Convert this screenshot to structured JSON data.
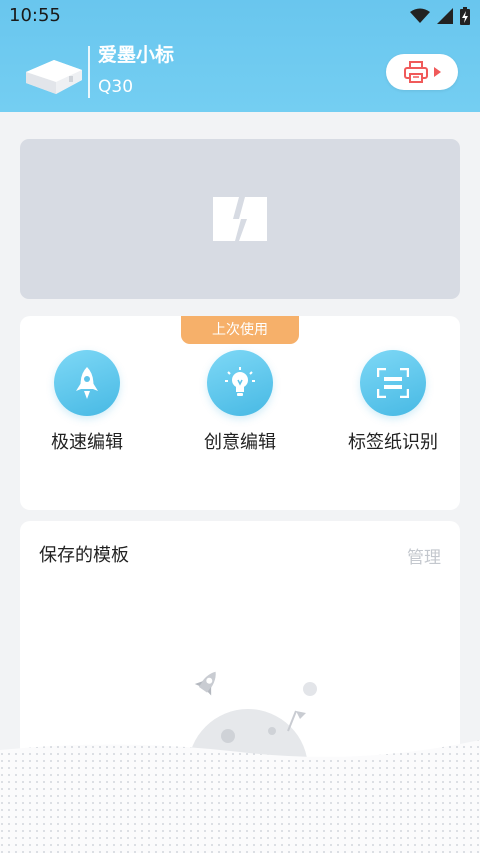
{
  "status_bar": {
    "time": "10:55",
    "icons": [
      "wifi-icon",
      "signal-icon",
      "battery-charging-icon"
    ]
  },
  "header": {
    "device_name": "爱墨小标",
    "device_model": "Q30",
    "print_button_icon": "printer-icon"
  },
  "banner": {
    "icon": "image-placeholder-icon"
  },
  "quick_actions": {
    "badge": "上次使用",
    "items": [
      {
        "label": "极速编辑",
        "icon": "rocket-icon"
      },
      {
        "label": "创意编辑",
        "icon": "lightbulb-icon"
      },
      {
        "label": "标签纸识别",
        "icon": "scan-icon"
      }
    ]
  },
  "templates": {
    "title": "保存的模板",
    "manage_label": "管理",
    "empty_illustration": "rocket-planet-illustration"
  },
  "colors": {
    "header": "#6ec9f0",
    "accent_blue": "#47b9e4",
    "badge_orange": "#f6b06a",
    "print_red": "#f05a5a"
  }
}
